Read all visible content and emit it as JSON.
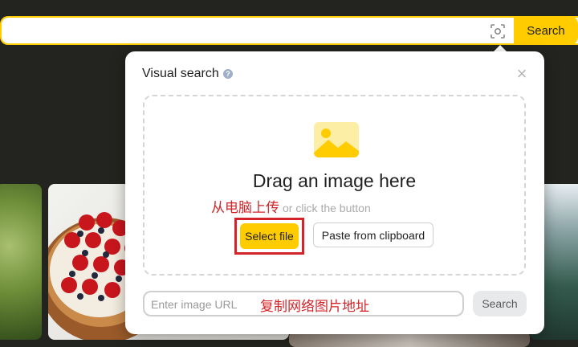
{
  "search": {
    "value": "",
    "button_label": "Search",
    "lens_icon": "camera-lens-icon"
  },
  "modal": {
    "title": "Visual search",
    "info_icon": "info-icon",
    "close_icon": "close-icon",
    "close_glyph": "×",
    "dropzone": {
      "image_icon": "image-placeholder-icon",
      "heading": "Drag an image here",
      "annotation": "从电脑上传",
      "subtext": "or click the button",
      "select_file_label": "Select file",
      "paste_label": "Paste from clipboard"
    },
    "url": {
      "placeholder": "Enter image URL",
      "annotation": "复制网络图片地址",
      "search_label": "Search"
    }
  },
  "colors": {
    "accent": "#ffcc00",
    "annotation_red": "#d2242a",
    "page_background": "#23231f"
  }
}
